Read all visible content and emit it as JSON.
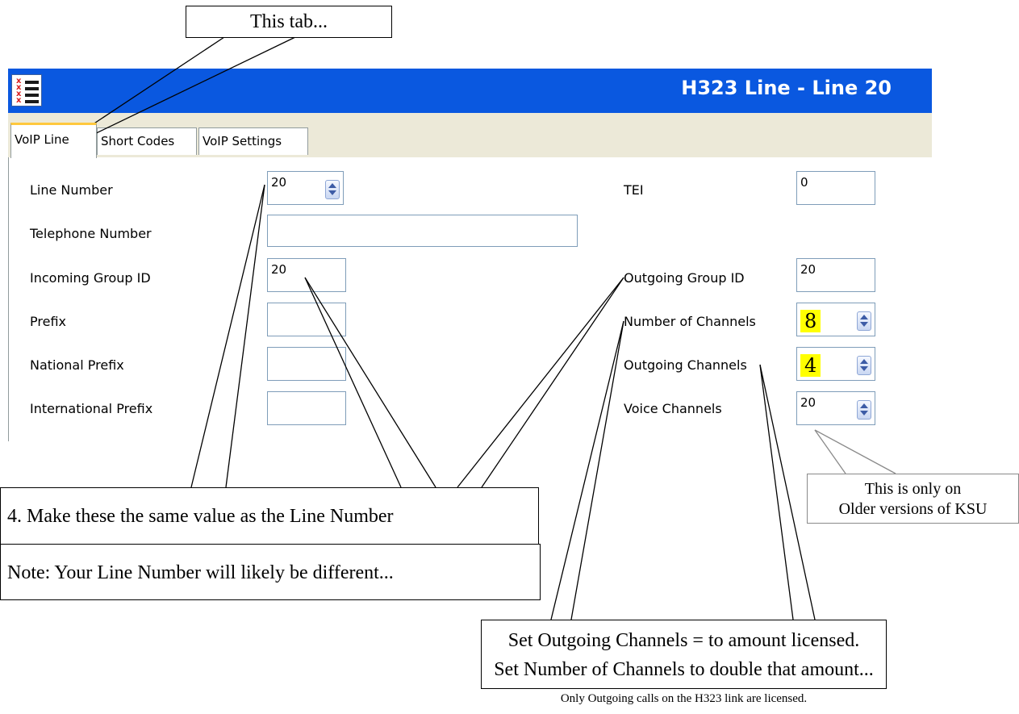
{
  "window": {
    "title": "H323 Line - Line 20",
    "icon": "list-icon"
  },
  "tabs": [
    {
      "label": "VoIP Line",
      "active": true
    },
    {
      "label": "Short Codes",
      "active": false
    },
    {
      "label": "VoIP Settings",
      "active": false
    }
  ],
  "form": {
    "line_number": {
      "label": "Line Number",
      "value": "20"
    },
    "telephone_number": {
      "label": "Telephone Number",
      "value": ""
    },
    "incoming_group_id": {
      "label": "Incoming Group ID",
      "value": "20"
    },
    "prefix": {
      "label": "Prefix",
      "value": ""
    },
    "national_prefix": {
      "label": "National Prefix",
      "value": ""
    },
    "international_prefix": {
      "label": "International Prefix",
      "value": ""
    },
    "tei": {
      "label": "TEI",
      "value": "0"
    },
    "outgoing_group_id": {
      "label": "Outgoing Group ID",
      "value": "20"
    },
    "number_of_channels": {
      "label": "Number of Channels",
      "value": "8"
    },
    "outgoing_channels": {
      "label": "Outgoing Channels",
      "value": "4"
    },
    "voice_channels": {
      "label": "Voice Channels",
      "value": "20"
    }
  },
  "annotations": {
    "tab_note": "This tab...",
    "same_value": "4. Make these the same value as the Line Number",
    "likely_different": "Note: Your Line Number will likely be different...",
    "older_line1": "This is only on",
    "older_line2": "Older versions of KSU",
    "channels_line1": "Set Outgoing Channels = to amount licensed.",
    "channels_line2": "Set Number of  Channels to double that amount...",
    "licensed_note": "Only Outgoing calls on the H323 link are licensed."
  },
  "colors": {
    "titlebar": "#0a58e0",
    "highlight": "#ffff00",
    "tab_accent": "#ffc83d",
    "field_border": "#7f9db9"
  }
}
